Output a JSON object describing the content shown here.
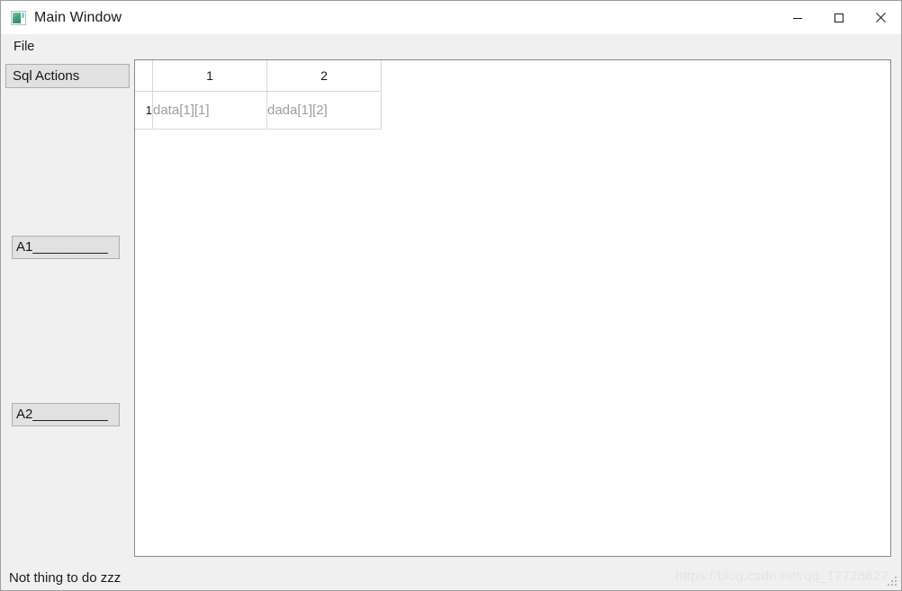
{
  "window": {
    "title": "Main Window",
    "icon": "app-window-icon",
    "controls": {
      "minimize": "minimize-icon",
      "maximize": "maximize-icon",
      "close": "close-icon"
    }
  },
  "menubar": {
    "items": [
      {
        "label": "File"
      }
    ]
  },
  "sidebar": {
    "tab_label": "Sql Actions",
    "buttons": [
      {
        "label": "A1__________"
      },
      {
        "label": "A2__________"
      }
    ]
  },
  "table": {
    "corner_label": "",
    "column_headers": [
      "1",
      "2"
    ],
    "rows": [
      {
        "header": "1",
        "cells": [
          "data[1][1]",
          "dada[1][2]"
        ]
      }
    ]
  },
  "statusbar": {
    "message": "Not thing to do zzz",
    "watermark": "https://blog.csdn.net/qq_17728627"
  }
}
